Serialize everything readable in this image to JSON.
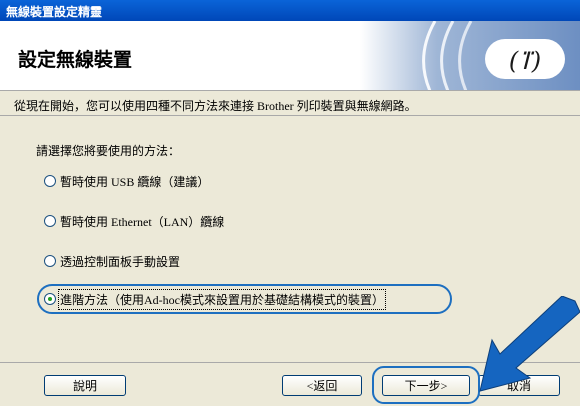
{
  "window": {
    "title": "無線裝置設定精靈"
  },
  "header": {
    "title": "設定無線裝置"
  },
  "intro": "從現在開始，您可以使用四種不同方法來連接 Brother 列印裝置與無線網路。",
  "prompt": "請選擇您將要使用的方法：",
  "options": [
    {
      "label": "暫時使用 USB 纜線（建議）",
      "selected": false
    },
    {
      "label": "暫時使用 Ethernet（LAN）纜線",
      "selected": false
    },
    {
      "label": "透過控制面板手動設置",
      "selected": false
    },
    {
      "label": "進階方法（使用Ad-hoc模式來設置用於基礎結構模式的裝置）",
      "selected": true
    }
  ],
  "buttons": {
    "help": "說明",
    "back": "<返回",
    "next": "下一步>",
    "cancel": "取消"
  },
  "colors": {
    "titlebar": "#0054e3",
    "highlight": "#1d6fc0",
    "accent_arrow": "#1565c0"
  }
}
